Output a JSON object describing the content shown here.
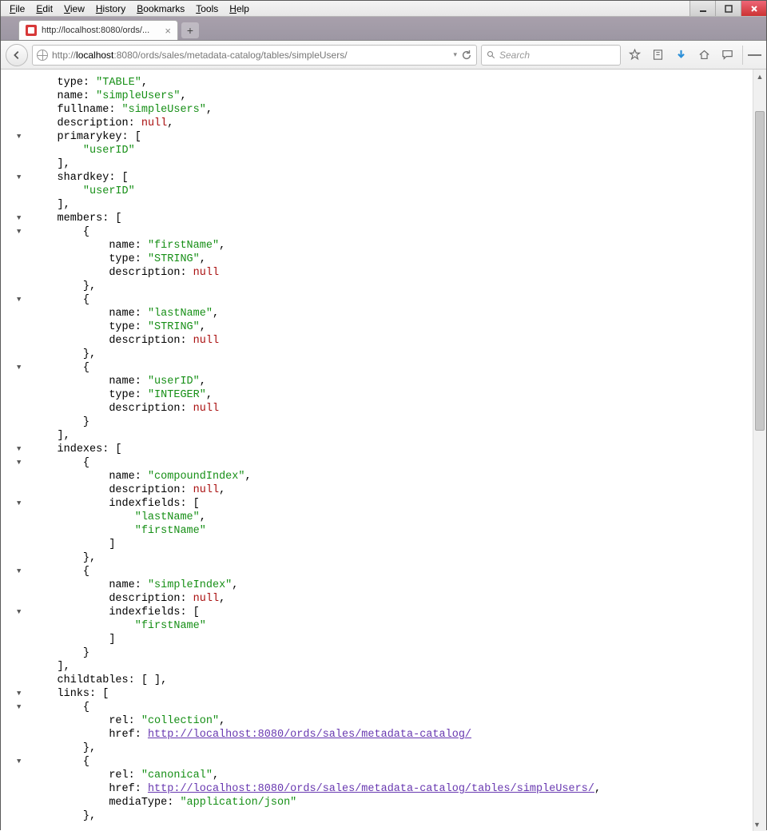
{
  "menu": {
    "file": "File",
    "edit": "Edit",
    "view": "View",
    "history": "History",
    "bookmarks": "Bookmarks",
    "tools": "Tools",
    "help": "Help"
  },
  "tab": {
    "title": "http://localhost:8080/ords/..."
  },
  "url": {
    "prefix": "http://",
    "host": "localhost",
    "rest": ":8080/ords/sales/metadata-catalog/tables/simpleUsers/"
  },
  "search": {
    "placeholder": "Search"
  },
  "json": {
    "type": "TABLE",
    "name": "simpleUsers",
    "fullname": "simpleUsers",
    "description": null,
    "primarykey": [
      "userID"
    ],
    "shardkey": [
      "userID"
    ],
    "members": [
      {
        "name": "firstName",
        "type": "STRING",
        "description": null
      },
      {
        "name": "lastName",
        "type": "STRING",
        "description": null
      },
      {
        "name": "userID",
        "type": "INTEGER",
        "description": null
      }
    ],
    "indexes": [
      {
        "name": "compoundIndex",
        "description": null,
        "indexfields": [
          "lastName",
          "firstName"
        ]
      },
      {
        "name": "simpleIndex",
        "description": null,
        "indexfields": [
          "firstName"
        ]
      }
    ],
    "childtables": [],
    "links": [
      {
        "rel": "collection",
        "href": "http://localhost:8080/ords/sales/metadata-catalog/"
      },
      {
        "rel": "canonical",
        "href": "http://localhost:8080/ords/sales/metadata-catalog/tables/simpleUsers/",
        "mediaType": "application/json"
      }
    ]
  },
  "labels": {
    "type": "type",
    "name": "name",
    "fullname": "fullname",
    "description": "description",
    "primarykey": "primarykey",
    "shardkey": "shardkey",
    "members": "members",
    "indexes": "indexes",
    "indexfields": "indexfields",
    "childtables": "childtables",
    "links": "links",
    "rel": "rel",
    "href": "href",
    "mediaType": "mediaType",
    "null": "null"
  }
}
